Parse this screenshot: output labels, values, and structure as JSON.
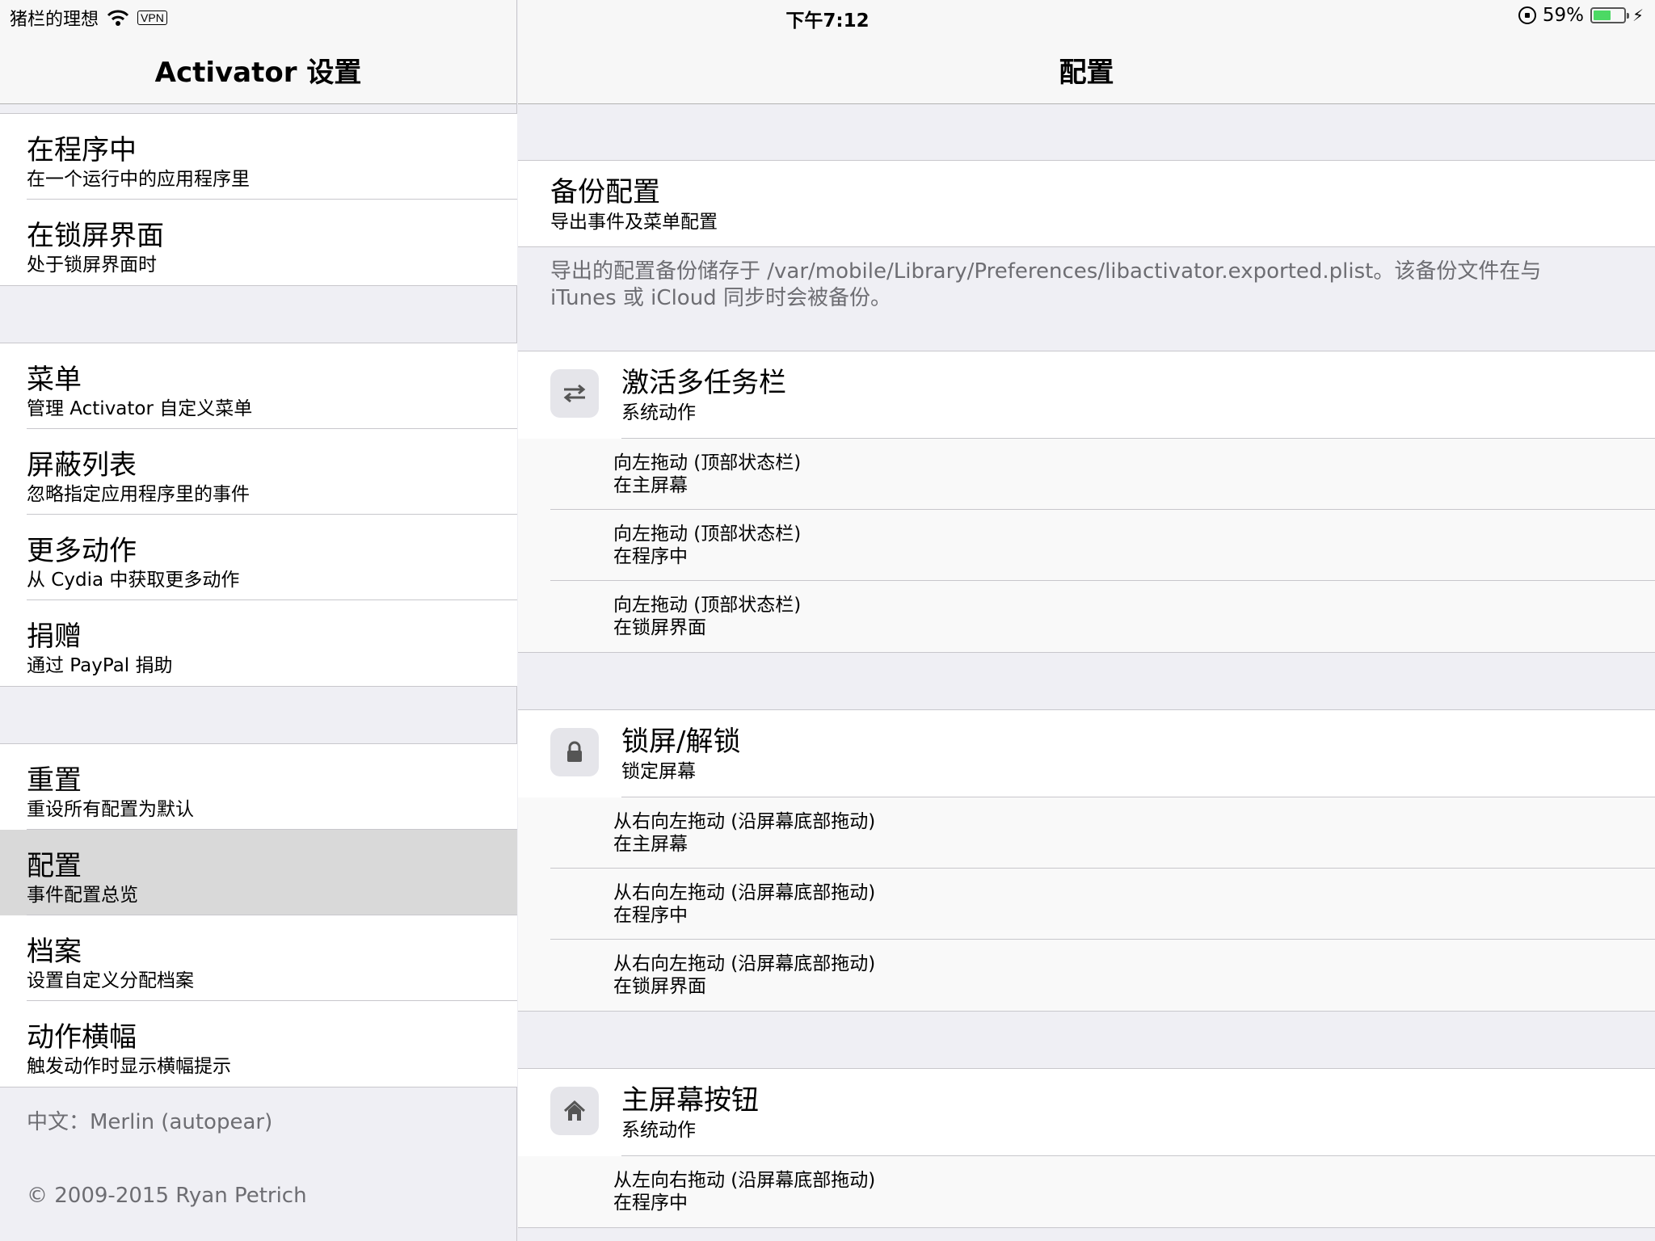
{
  "status_bar": {
    "carrier": "猪栏的理想",
    "vpn": "VPN",
    "time": "下午7:12",
    "battery": "59%",
    "battery_level": 0.59,
    "battery_color": "#4cd964"
  },
  "master": {
    "title": "Activator 设置",
    "groups": [
      [
        {
          "title": "在程序中",
          "subtitle": "在一个运行中的应用程序里"
        },
        {
          "title": "在锁屏界面",
          "subtitle": "处于锁屏界面时"
        }
      ],
      [
        {
          "title": "菜单",
          "subtitle": "管理 Activator 自定义菜单"
        },
        {
          "title": "屏蔽列表",
          "subtitle": "忽略指定应用程序里的事件"
        },
        {
          "title": "更多动作",
          "subtitle": "从 Cydia 中获取更多动作"
        },
        {
          "title": "捐赠",
          "subtitle": "通过 PayPal 捐助"
        }
      ],
      [
        {
          "title": "重置",
          "subtitle": "重设所有配置为默认"
        },
        {
          "title": "配置",
          "subtitle": "事件配置总览"
        },
        {
          "title": "档案",
          "subtitle": "设置自定义分配档案"
        },
        {
          "title": "动作横幅",
          "subtitle": "触发动作时显示横幅提示"
        }
      ]
    ],
    "translator": "中文：Merlin (autopear)",
    "copyright": "© 2009-2015 Ryan Petrich"
  },
  "detail": {
    "title": "配置",
    "backup": {
      "title": "备份配置",
      "subtitle": "导出事件及菜单配置",
      "note": "导出的配置备份储存于 /var/mobile/Library/Preferences/libactivator.exported.plist。该备份文件在与 iTunes 或 iCloud 同步时会被备份。"
    },
    "actions": [
      {
        "icon": "switcher-arrows-icon",
        "title": "激活多任务栏",
        "subtitle": "系统动作",
        "events": [
          {
            "title": "向左拖动 (顶部状态栏)",
            "subtitle": "在主屏幕"
          },
          {
            "title": "向左拖动 (顶部状态栏)",
            "subtitle": "在程序中"
          },
          {
            "title": "向左拖动 (顶部状态栏)",
            "subtitle": "在锁屏界面"
          }
        ]
      },
      {
        "icon": "lock-icon",
        "title": "锁屏/解锁",
        "subtitle": "锁定屏幕",
        "events": [
          {
            "title": "从右向左拖动 (沿屏幕底部拖动)",
            "subtitle": "在主屏幕"
          },
          {
            "title": "从右向左拖动 (沿屏幕底部拖动)",
            "subtitle": "在程序中"
          },
          {
            "title": "从右向左拖动 (沿屏幕底部拖动)",
            "subtitle": "在锁屏界面"
          }
        ]
      },
      {
        "icon": "home-icon",
        "title": "主屏幕按钮",
        "subtitle": "系统动作",
        "events": [
          {
            "title": "从左向右拖动 (沿屏幕底部拖动)",
            "subtitle": "在程序中"
          }
        ]
      }
    ]
  }
}
